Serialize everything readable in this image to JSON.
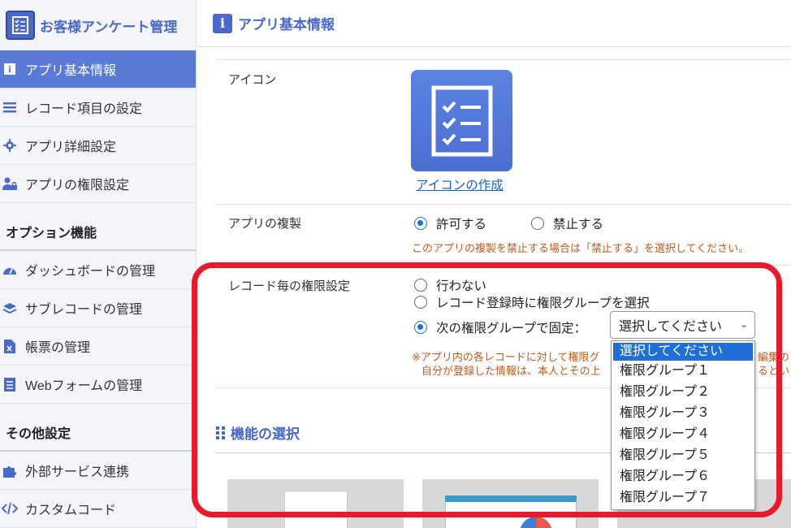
{
  "app": {
    "title": "お客様アンケート管理"
  },
  "sidebar": {
    "items": [
      {
        "label": "アプリ基本情報",
        "icon": "info-icon",
        "active": true
      },
      {
        "label": "レコード項目の設定",
        "icon": "list-icon"
      },
      {
        "label": "アプリ詳細設定",
        "icon": "gear-icon"
      },
      {
        "label": "アプリの権限設定",
        "icon": "user-lock-icon"
      }
    ],
    "option_section": "オプション機能",
    "option_items": [
      {
        "label": "ダッシュボードの管理",
        "icon": "dashboard-icon"
      },
      {
        "label": "サブレコードの管理",
        "icon": "layers-icon"
      },
      {
        "label": "帳票の管理",
        "icon": "excel-file-icon"
      },
      {
        "label": "Webフォームの管理",
        "icon": "form-icon"
      }
    ],
    "other_section": "その他設定",
    "other_items": [
      {
        "label": "外部サービス連携",
        "icon": "puzzle-icon"
      },
      {
        "label": "カスタムコード",
        "icon": "code-icon"
      }
    ]
  },
  "main": {
    "title": "アプリ基本情報",
    "info_badge": "i",
    "icon_row": {
      "label": "アイコン",
      "link": "アイコンの作成"
    },
    "duplicate_row": {
      "label": "アプリの複製",
      "options": [
        "許可する",
        "禁止する"
      ],
      "selected": "許可する",
      "note": "このアプリの複製を禁止する場合は「禁止する」を選択してください。"
    },
    "permission_row": {
      "label": "レコード毎の権限設定",
      "options": [
        "行わない",
        "レコード登録時に権限グループを選択",
        "次の権限グループで固定："
      ],
      "selected": "次の権限グループで固定：",
      "select_value": "選択してください",
      "note_line1": "※アプリ内の各レコードに対して権限グ",
      "note_line1_tail": "編集の",
      "note_line2": "自分が登録した情報は、本人とその上",
      "note_line2_tail": "るとい"
    },
    "dropdown": {
      "options": [
        "選択してください",
        "権限グループ１",
        "権限グループ２",
        "権限グループ３",
        "権限グループ４",
        "権限グループ５",
        "権限グループ６",
        "権限グループ７"
      ],
      "highlighted": "選択してください"
    },
    "feature_title": "機能の選択"
  },
  "colors": {
    "accent": "#4a69c8",
    "active_nav": "#5a7ad8",
    "radio": "#1e6fd9",
    "note": "#c35a1a",
    "highlight_frame": "#e8192a"
  }
}
